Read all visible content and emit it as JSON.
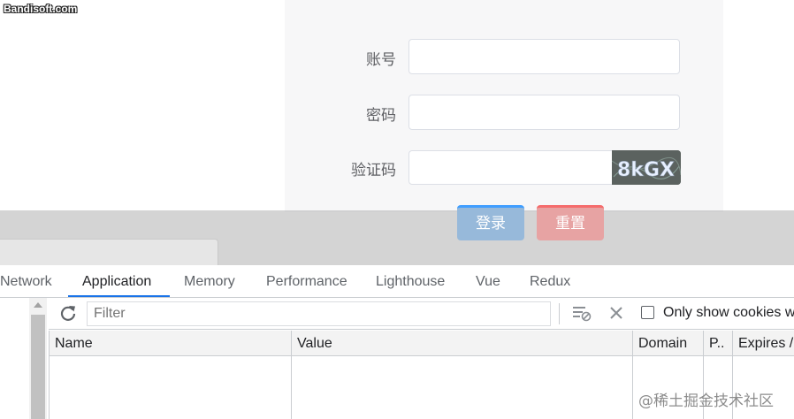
{
  "watermark_top": "Bandisoft.com",
  "login_form": {
    "account_label": "账号",
    "password_label": "密码",
    "captcha_label": "验证码",
    "captcha_text": "8kGX",
    "login_button": "登录",
    "reset_button": "重置"
  },
  "devtools": {
    "tabs": [
      {
        "label": "Network"
      },
      {
        "label": "Application",
        "active": true
      },
      {
        "label": "Memory"
      },
      {
        "label": "Performance"
      },
      {
        "label": "Lighthouse"
      },
      {
        "label": "Vue"
      },
      {
        "label": "Redux"
      }
    ],
    "toolbar": {
      "filter_placeholder": "Filter",
      "only_show_cookies_label": "Only show cookies w"
    },
    "table_headers": [
      "Name",
      "Value",
      "Domain",
      "P..",
      "Expires /"
    ]
  },
  "watermark_bottom": "@稀土掘金技术社区",
  "colors": {
    "primary": "#409eff",
    "danger": "#f56c6c",
    "tab_active_underline": "#1a73e8"
  },
  "icons": [
    "refresh-icon",
    "clear-filter-icon",
    "delete-icon",
    "scroll-up-arrow-icon"
  ]
}
